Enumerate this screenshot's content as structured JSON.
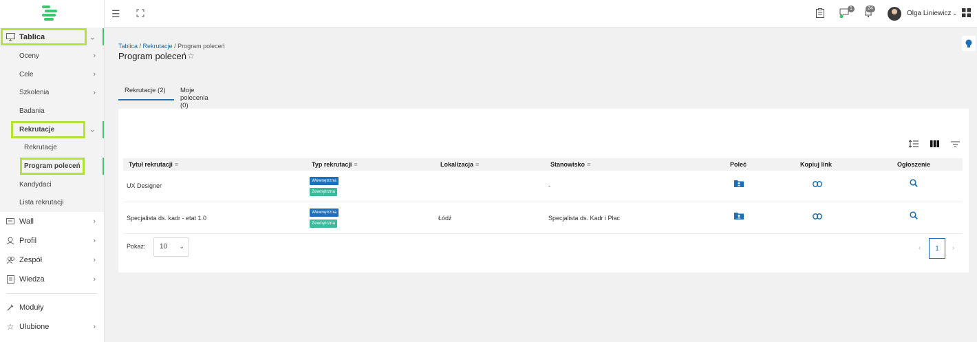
{
  "sidebar": {
    "items": [
      {
        "label": "Tablica",
        "icon": "monitor-icon"
      },
      {
        "label": "Oceny"
      },
      {
        "label": "Cele"
      },
      {
        "label": "Szkolenia"
      },
      {
        "label": "Badania"
      },
      {
        "label": "Rekrutacje"
      },
      {
        "label": "Rekrutacje"
      },
      {
        "label": "Program poleceń"
      },
      {
        "label": "Kandydaci"
      },
      {
        "label": "Lista rekrutacji"
      },
      {
        "label": "Wall",
        "icon": "wall-icon"
      },
      {
        "label": "Profil",
        "icon": "profile-icon"
      },
      {
        "label": "Zespół",
        "icon": "team-icon"
      },
      {
        "label": "Wiedza",
        "icon": "knowledge-icon"
      },
      {
        "label": "Moduły",
        "icon": "modules-icon"
      },
      {
        "label": "Ulubione",
        "icon": "star-icon"
      }
    ]
  },
  "topbar": {
    "chat_badge": "1",
    "notif_badge": "24",
    "user_name": "Olga Liniewicz"
  },
  "breadcrumb": {
    "part1": "Tablica",
    "sep1": " / ",
    "part2": "Rekrutacje",
    "sep2": " / ",
    "current": "Program poleceń"
  },
  "page_title": "Program poleceń",
  "tabs": [
    {
      "label": "Rekrutacje (2)"
    },
    {
      "label": "Moje polecenia (0)"
    }
  ],
  "table": {
    "headers": [
      "Tytuł rekrutacji",
      "Typ rekrutacji",
      "Lokalizacja",
      "Stanowisko",
      "Poleć",
      "Kopiuj link",
      "Ogłoszenie"
    ],
    "rows": [
      {
        "title": "UX Designer",
        "tag1": "Wewnętrzna",
        "tag2": "Zewnętrzna",
        "location": "",
        "position": "-"
      },
      {
        "title": "Specjalista ds. kadr - etat 1.0",
        "tag1": "Wewnętrzna",
        "tag2": "Zewnętrzna",
        "location": "Łódź",
        "position": "Specjalista ds. Kadr i Płac"
      }
    ]
  },
  "pager": {
    "label": "Pokaż:",
    "page_size": "10",
    "current_page": "1"
  },
  "colors": {
    "accent": "#1e6fb8",
    "highlight": "#b4e13a",
    "brand": "#39c96b",
    "tag_internal": "#1e6fb8",
    "tag_external": "#3cb99a"
  }
}
